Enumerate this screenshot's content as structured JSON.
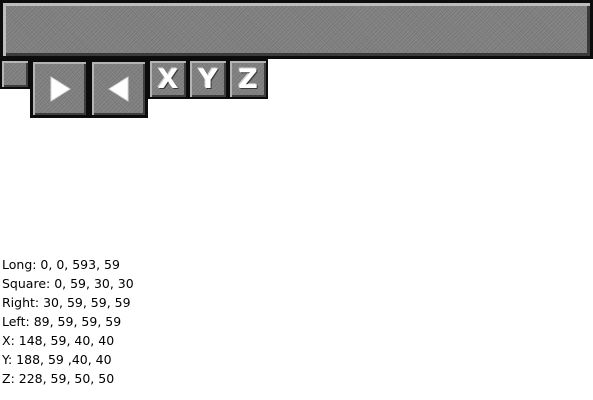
{
  "buttons": {
    "long": {
      "name": "Long"
    },
    "square": {
      "name": "Square"
    },
    "right": {
      "name": "Right",
      "icon": "play-right-icon"
    },
    "left": {
      "name": "Left",
      "icon": "play-left-icon"
    },
    "x": {
      "label": "X"
    },
    "y": {
      "label": "Y"
    },
    "z": {
      "label": "Z"
    }
  },
  "colors": {
    "button_face": "#7e7e7e",
    "button_border": "#0c0c0c",
    "glyph": "#ffffff",
    "text": "#000000"
  },
  "info_lines": [
    "Long: 0, 0, 593, 59",
    "Square: 0, 59, 30, 30",
    "Right: 30, 59, 59, 59",
    "Left: 89, 59, 59, 59",
    "X: 148, 59, 40, 40",
    "Y: 188, 59 ,40, 40",
    "Z: 228, 59, 50, 50"
  ]
}
